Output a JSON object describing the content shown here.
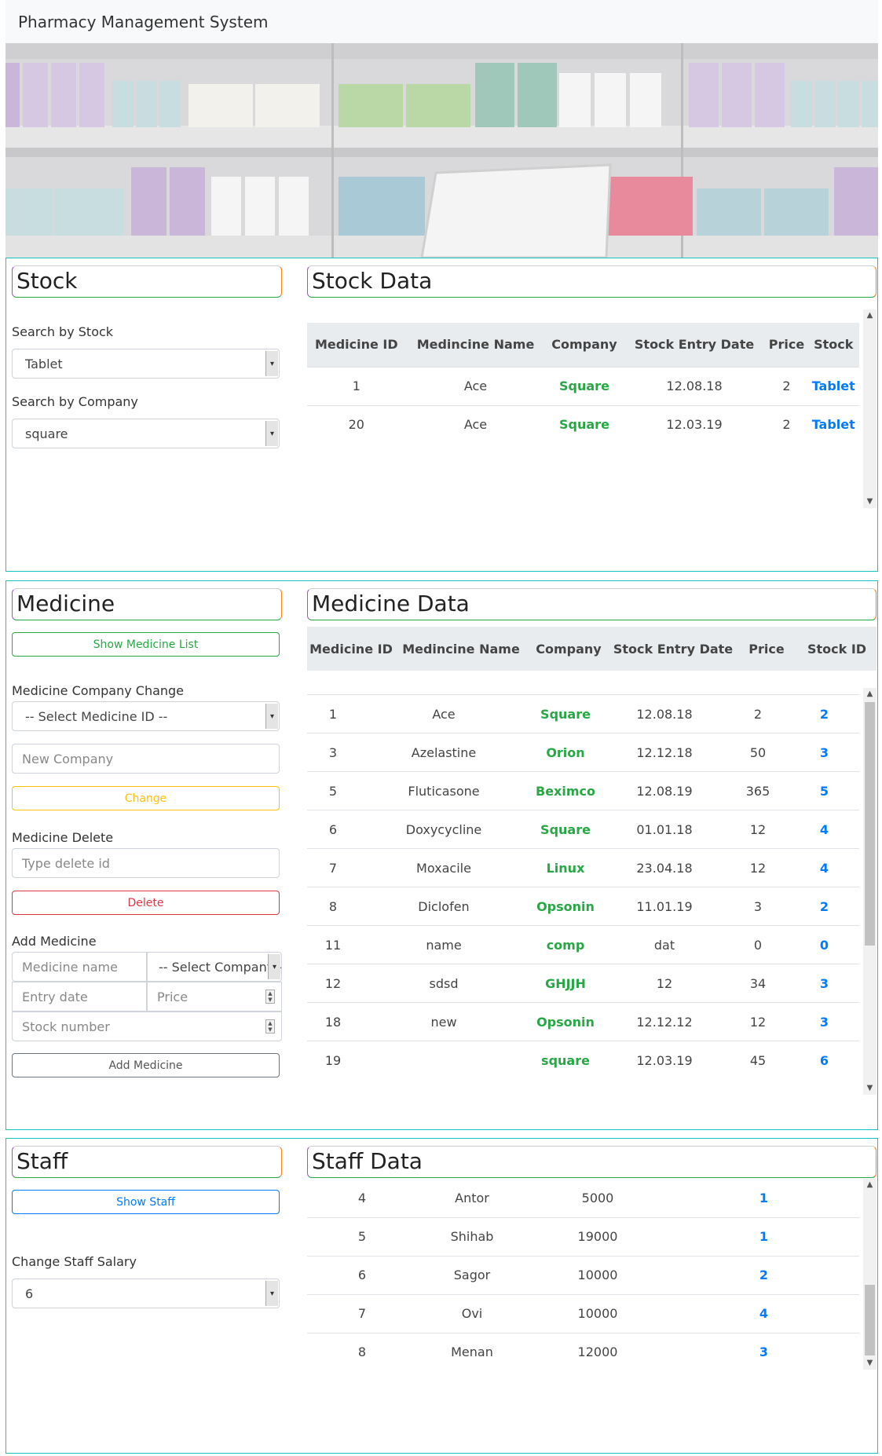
{
  "app": {
    "title": "Pharmacy Management System"
  },
  "stock": {
    "heading": "Stock",
    "search_stock_label": "Search by Stock",
    "search_stock_value": "Tablet",
    "search_company_label": "Search by Company",
    "search_company_value": "square",
    "data_heading": "Stock Data",
    "columns": [
      "Medicine ID",
      "Medincine Name",
      "Company",
      "Stock Entry Date",
      "Price",
      "Stock"
    ],
    "rows": [
      [
        "1",
        "Ace",
        "Square",
        "12.08.18",
        "2",
        "Tablet"
      ],
      [
        "20",
        "Ace",
        "Square",
        "12.03.19",
        "2",
        "Tablet"
      ]
    ]
  },
  "medicine": {
    "heading": "Medicine",
    "show_list_label": "Show Medicine List",
    "company_change_label": "Medicine Company Change",
    "select_id_value": "-- Select Medicine ID --",
    "new_company_placeholder": "New Company",
    "change_label": "Change",
    "delete_label": "Medicine Delete",
    "delete_placeholder": "Type delete id",
    "delete_button": "Delete",
    "add_label": "Add Medicine",
    "name_placeholder": "Medicine name",
    "company_select_value": "-- Select Company --",
    "date_placeholder": "Entry date",
    "price_placeholder": "Price",
    "stock_placeholder": "Stock number",
    "add_button": "Add Medicine",
    "data_heading": "Medicine Data",
    "columns": [
      "Medicine ID",
      "Medincine Name",
      "Company",
      "Stock Entry Date",
      "Price",
      "Stock ID"
    ],
    "rows": [
      [
        "1",
        "Ace",
        "Square",
        "12.08.18",
        "2",
        "2"
      ],
      [
        "3",
        "Azelastine",
        "Orion",
        "12.12.18",
        "50",
        "3"
      ],
      [
        "5",
        "Fluticasone",
        "Beximco",
        "12.08.19",
        "365",
        "5"
      ],
      [
        "6",
        "Doxycycline",
        "Square",
        "01.01.18",
        "12",
        "4"
      ],
      [
        "7",
        "Moxacile",
        "Linux",
        "23.04.18",
        "12",
        "4"
      ],
      [
        "8",
        "Diclofen",
        "Opsonin",
        "11.01.19",
        "3",
        "2"
      ],
      [
        "11",
        "name",
        "comp",
        "dat",
        "0",
        "0"
      ],
      [
        "12",
        "sdsd",
        "GHJJH",
        "12",
        "34",
        "3"
      ],
      [
        "18",
        "new",
        "Opsonin",
        "12.12.12",
        "12",
        "3"
      ],
      [
        "19",
        "",
        "square",
        "12.03.19",
        "45",
        "6"
      ]
    ]
  },
  "staff": {
    "heading": "Staff",
    "show_button": "Show Staff",
    "salary_label": "Change Staff Salary",
    "salary_select_value": "6",
    "data_heading": "Staff Data",
    "rows": [
      [
        "4",
        "Antor",
        "5000",
        "1"
      ],
      [
        "5",
        "Shihab",
        "19000",
        "1"
      ],
      [
        "6",
        "Sagor",
        "10000",
        "2"
      ],
      [
        "7",
        "Ovi",
        "10000",
        "4"
      ],
      [
        "8",
        "Menan",
        "12000",
        "3"
      ]
    ]
  },
  "icons": {
    "caret": "chevron-down-icon",
    "scroll_up": "scroll-up-icon",
    "scroll_down": "scroll-down-icon"
  }
}
